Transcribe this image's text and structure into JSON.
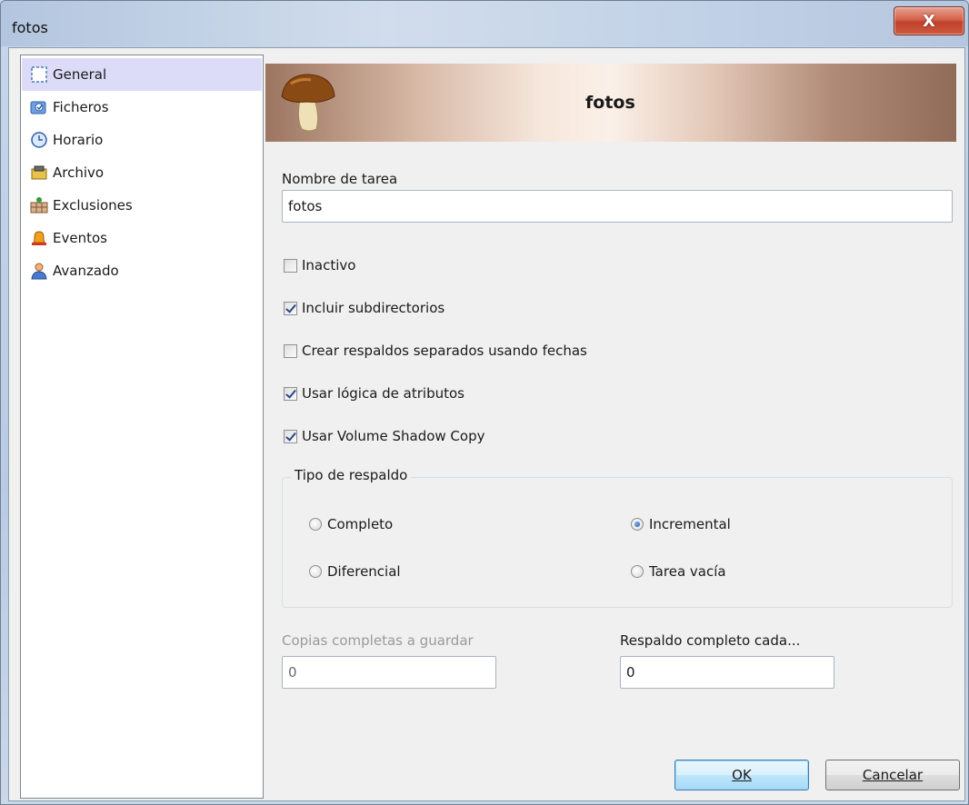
{
  "window": {
    "title": "fotos",
    "close_label": "X"
  },
  "sidebar": {
    "items": [
      {
        "label": "General",
        "icon": "general-page-icon",
        "selected": true
      },
      {
        "label": "Ficheros",
        "icon": "files-icon"
      },
      {
        "label": "Horario",
        "icon": "clock-icon"
      },
      {
        "label": "Archivo",
        "icon": "archive-icon"
      },
      {
        "label": "Exclusiones",
        "icon": "exclusions-icon"
      },
      {
        "label": "Eventos",
        "icon": "bell-icon"
      },
      {
        "label": "Avanzado",
        "icon": "user-icon"
      }
    ]
  },
  "banner": {
    "title": "fotos",
    "icon": "mushroom-icon"
  },
  "form": {
    "task_name_label": "Nombre de tarea",
    "task_name_value": "fotos",
    "checks": [
      {
        "label": "Inactivo",
        "checked": false
      },
      {
        "label": "Incluir subdirectorios",
        "checked": true
      },
      {
        "label": "Crear respaldos separados usando fechas",
        "checked": false
      },
      {
        "label": "Usar lógica de atributos",
        "checked": true
      },
      {
        "label": "Usar Volume Shadow Copy",
        "checked": true
      }
    ],
    "backup_type": {
      "legend": "Tipo de respaldo",
      "options": [
        {
          "label": "Completo",
          "selected": false
        },
        {
          "label": "Incremental",
          "selected": true
        },
        {
          "label": "Diferencial",
          "selected": false
        },
        {
          "label": "Tarea vacía",
          "selected": false
        }
      ]
    },
    "full_copies_label": "Copias completas a guardar",
    "full_copies_value": "0",
    "full_every_label": "Respaldo completo cada...",
    "full_every_value": "0"
  },
  "buttons": {
    "ok_label": "OK",
    "cancel_label": "Cancelar"
  },
  "colors": {
    "selection": "#dcdcf8",
    "close_button": "#c84a32",
    "disabled_text": "#9a9a9a"
  }
}
